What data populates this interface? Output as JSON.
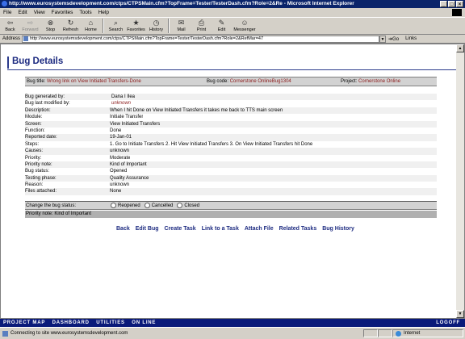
{
  "window": {
    "title": "http://www.eurosystemsdevelopment.com/ctps/CTPSMain.cfm?TopFrame=Tester/TesterDash.cfm?Role=2&Re - Microsoft Internet Explorer"
  },
  "menu": [
    "File",
    "Edit",
    "View",
    "Favorites",
    "Tools",
    "Help"
  ],
  "toolbar": {
    "back": "Back",
    "forward": "Forward",
    "stop": "Stop",
    "refresh": "Refresh",
    "home": "Home",
    "search": "Search",
    "favorites": "Favorites",
    "history": "History",
    "mail": "Mail",
    "print": "Print",
    "edit": "Edit",
    "messenger": "Messenger"
  },
  "address": {
    "label": "Address",
    "url": "http://www.eurosystemsdevelopment.com/ctps/CTPSMain.cfm?TopFrame=Tester/TesterDash.cfm?Role=2&RefMar=47",
    "go": "Go",
    "links": "Links"
  },
  "page": {
    "title": "Bug Details",
    "summary": {
      "bug_title_label": "Bug title:",
      "bug_title": "Wrong link on View Initiated Transfers-Done",
      "bug_code_label": "Bug code:",
      "bug_code": "Cornerstone OnlineBug1304",
      "project_label": "Project:",
      "project": "Cornerstone Online"
    },
    "details": [
      {
        "label": "Bug generated by:",
        "value": "Dana I Ilea"
      },
      {
        "label": "Bug last modified by:",
        "value": "unknown"
      },
      {
        "label": "Description:",
        "value": "When I hit Done on View Initiated Transfers it takes me back to TTS main screen"
      },
      {
        "label": "Module:",
        "value": "Initiate Transfer"
      },
      {
        "label": "Screen:",
        "value": "View Initiated Transfers"
      },
      {
        "label": "Function:",
        "value": "Done"
      },
      {
        "label": "Reported date:",
        "value": "19-Jan-01"
      },
      {
        "label": "Steps:",
        "value": "1. Go to Initiate Transfers 2. Hit View Initiated Transfers 3. On View Initiated Transfers hit Done"
      },
      {
        "label": "Causes:",
        "value": "unknown"
      },
      {
        "label": "Priority:",
        "value": "Moderate"
      },
      {
        "label": "Priority note:",
        "value": "Kind of Important"
      },
      {
        "label": "Bug status:",
        "value": "Opened"
      },
      {
        "label": "Testing phase:",
        "value": "Quality Assurance"
      },
      {
        "label": "Reason:",
        "value": "unknown"
      },
      {
        "label": "Files attached:",
        "value": "None"
      }
    ],
    "change_status": {
      "label": "Change the bug status:",
      "options": [
        "Reopened",
        "Cancelled",
        "Closed"
      ]
    },
    "priority_note_bar": "Priority note: Kind of Important",
    "actions": {
      "back": "Back",
      "edit_bug": "Edit Bug",
      "create_task": "Create Task",
      "link_task": "Link to a Task",
      "attach_file": "Attach File",
      "related_tasks": "Related Tasks",
      "bug_history": "Bug History"
    }
  },
  "footer": {
    "nav": [
      "Project Map",
      "Dashboard",
      "Utilities",
      "On Line"
    ],
    "logoff": "Logoff"
  },
  "statusbar": {
    "text": "Connecting to site www.eurosystemsdevelopment.com",
    "zone": "Internet"
  }
}
